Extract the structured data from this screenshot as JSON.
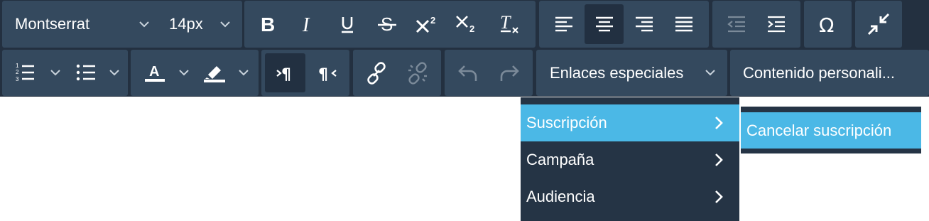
{
  "toolbar": {
    "font_family": "Montserrat",
    "font_size": "14px",
    "special_links_label": "Enlaces especiales",
    "custom_content_label": "Contenido personali...",
    "buttons": [
      "bold",
      "italic",
      "underline",
      "strikethrough",
      "superscript",
      "subscript",
      "clear-format",
      "align-left",
      "align-center",
      "align-right",
      "justify",
      "outdent",
      "indent",
      "special-characters",
      "minimize",
      "ordered-list",
      "unordered-list",
      "text-color",
      "background-color",
      "ltr",
      "rtl",
      "link",
      "unlink",
      "undo",
      "redo"
    ]
  },
  "menu": {
    "items": [
      {
        "label": "Suscripción"
      },
      {
        "label": "Campaña"
      },
      {
        "label": "Audiencia"
      }
    ],
    "submenu": {
      "items": [
        {
          "label": "Cancelar suscripción"
        }
      ]
    }
  },
  "colors": {
    "toolbar_bg": "#233040",
    "group_bg": "#34495e",
    "active_bg": "#223041",
    "menu_bg": "#253445",
    "highlight": "#4bb8e6"
  }
}
